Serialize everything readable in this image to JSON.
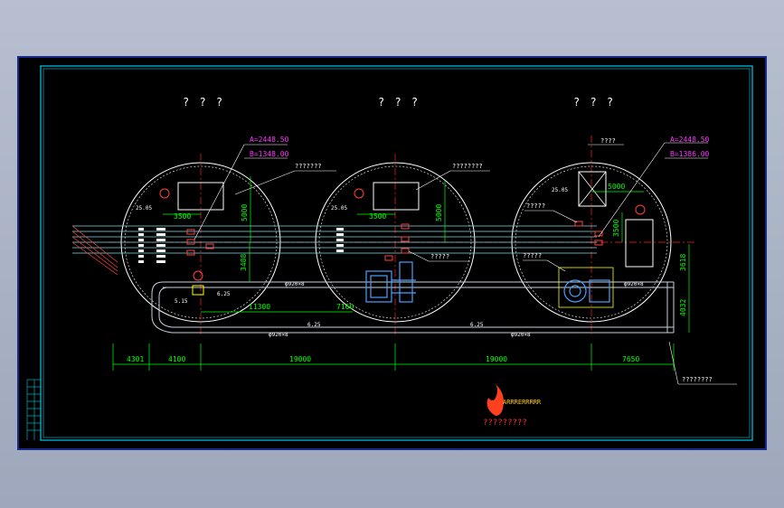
{
  "tanks": [
    {
      "title": "? ? ?",
      "callout": "",
      "coord_a": "A=2448.50",
      "coord_b": "B=1348.00",
      "elev": "25.05",
      "dim_h": "3500",
      "dim_v": "5000",
      "dim_v2": "3488"
    },
    {
      "title": "? ? ?",
      "callout": "???????",
      "callout2": "????????",
      "elev": "25.05",
      "dim_h": "3500",
      "dim_v": "5000",
      "callout3": "?????"
    },
    {
      "title": "? ? ?",
      "top_label": "????",
      "coord_a": "A=2448.50",
      "coord_b": "B=1386.00",
      "elev": "25.05",
      "dim_h": "5000",
      "dim_v": "3500",
      "callout": "?????",
      "callout2": "?????"
    }
  ],
  "pipes": {
    "main_upper": "φ920×8",
    "main_upper2": "φ920×8",
    "main_lower": "φ920×8",
    "main_lower2": "φ920×8",
    "slope_a": "6.25",
    "slope_b": "6.25",
    "slope_c": "6.25",
    "elev_left": "5.15"
  },
  "dimensions": {
    "d1": "4301",
    "d2": "4100",
    "d3": "19000",
    "d4": "19000",
    "d5": "7650",
    "d6": "11300",
    "d7": "7160",
    "d8": "3618",
    "d9": "4032"
  },
  "callout_bottom_right": "????????",
  "logo": {
    "top_text": "ARRRERRRRR",
    "sub_text": "?????????"
  }
}
